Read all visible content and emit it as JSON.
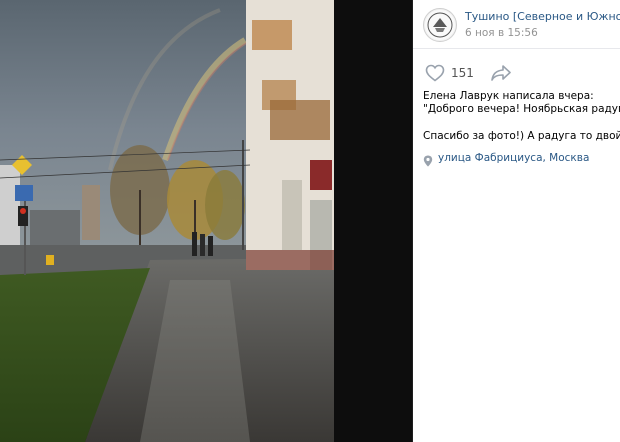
{
  "post": {
    "group_name": "Тушино [Северное и Южное]",
    "date": "6 ноя в 15:56",
    "likes": "151",
    "text_line1": "Елена Лаврук написала вчера:",
    "text_line2": "\"Доброго вечера! Ноябрьская радуга!\"",
    "text_line3": "Спасибо за фото!) А радуга то двойная",
    "location": "улица Фабрициуса, Москва"
  },
  "icons": {
    "like": "heart-outline-icon",
    "share": "share-arrow-icon",
    "location": "map-pin-icon",
    "avatar": "group-emblem"
  },
  "colors": {
    "link": "#2a5885",
    "muted": "#939393",
    "icon": "#99a2ad"
  }
}
